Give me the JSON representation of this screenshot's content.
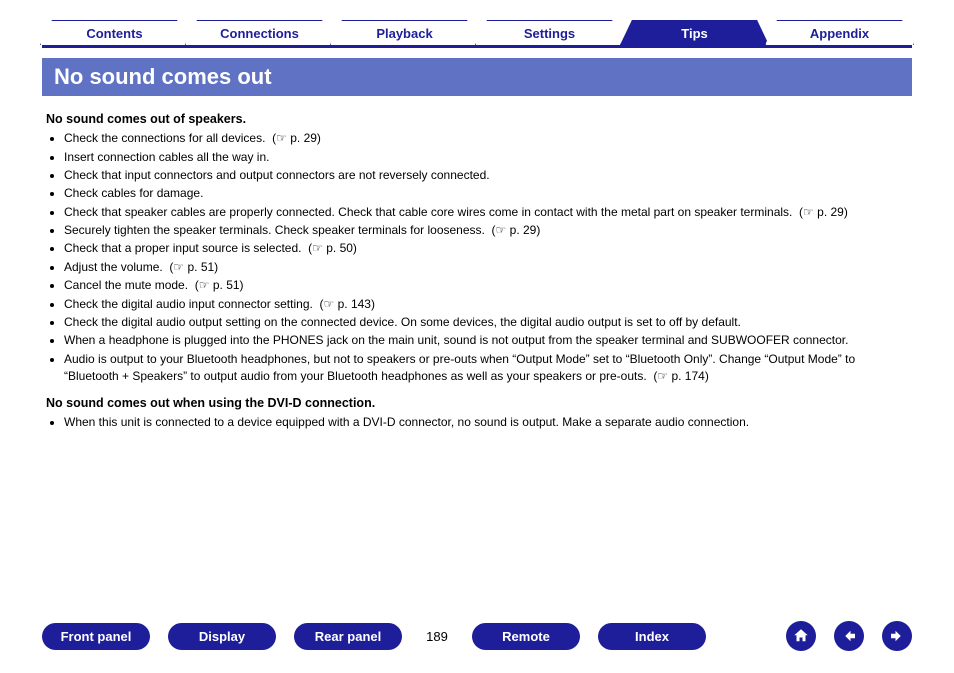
{
  "tabs": [
    {
      "label": "Contents",
      "active": false
    },
    {
      "label": "Connections",
      "active": false
    },
    {
      "label": "Playback",
      "active": false
    },
    {
      "label": "Settings",
      "active": false
    },
    {
      "label": "Tips",
      "active": true
    },
    {
      "label": "Appendix",
      "active": false
    }
  ],
  "title": "No sound comes out",
  "sections": [
    {
      "heading": "No sound comes out of speakers.",
      "items": [
        {
          "text": "Check the connections for all devices.",
          "ref": "p. 29"
        },
        {
          "text": "Insert connection cables all the way in."
        },
        {
          "text": "Check that input connectors and output connectors are not reversely connected."
        },
        {
          "text": "Check cables for damage."
        },
        {
          "text": "Check that speaker cables are properly connected. Check that cable core wires come in contact with the metal part on speaker terminals.",
          "ref": "p. 29"
        },
        {
          "text": "Securely tighten the speaker terminals. Check speaker terminals for looseness.",
          "ref": "p. 29"
        },
        {
          "text": "Check that a proper input source is selected.",
          "ref": "p. 50"
        },
        {
          "text": "Adjust the volume.",
          "ref": "p. 51"
        },
        {
          "text": "Cancel the mute mode.",
          "ref": "p. 51"
        },
        {
          "text": "Check the digital audio input connector setting.",
          "ref": "p. 143"
        },
        {
          "text": "Check the digital audio output setting on the connected device. On some devices, the digital audio output is set to off by default."
        },
        {
          "text": "When a headphone is plugged into the PHONES jack on the main unit, sound is not output from the speaker terminal and SUBWOOFER connector."
        },
        {
          "text": "Audio is output to your Bluetooth headphones, but not to speakers or pre-outs when “Output Mode” set to “Bluetooth Only”. Change “Output Mode” to “Bluetooth + Speakers” to output audio from your Bluetooth headphones as well as your speakers or pre-outs.",
          "ref": "p. 174"
        }
      ]
    },
    {
      "heading": "No sound comes out when using the DVI-D connection.",
      "items": [
        {
          "text": "When this unit is connected to a device equipped with a DVI-D connector, no sound is output. Make a separate audio connection."
        }
      ]
    }
  ],
  "footer": {
    "buttons": [
      "Front panel",
      "Display",
      "Rear panel"
    ],
    "page": "189",
    "buttons2": [
      "Remote",
      "Index"
    ]
  },
  "icons": {
    "ref_glyph": "☞"
  }
}
